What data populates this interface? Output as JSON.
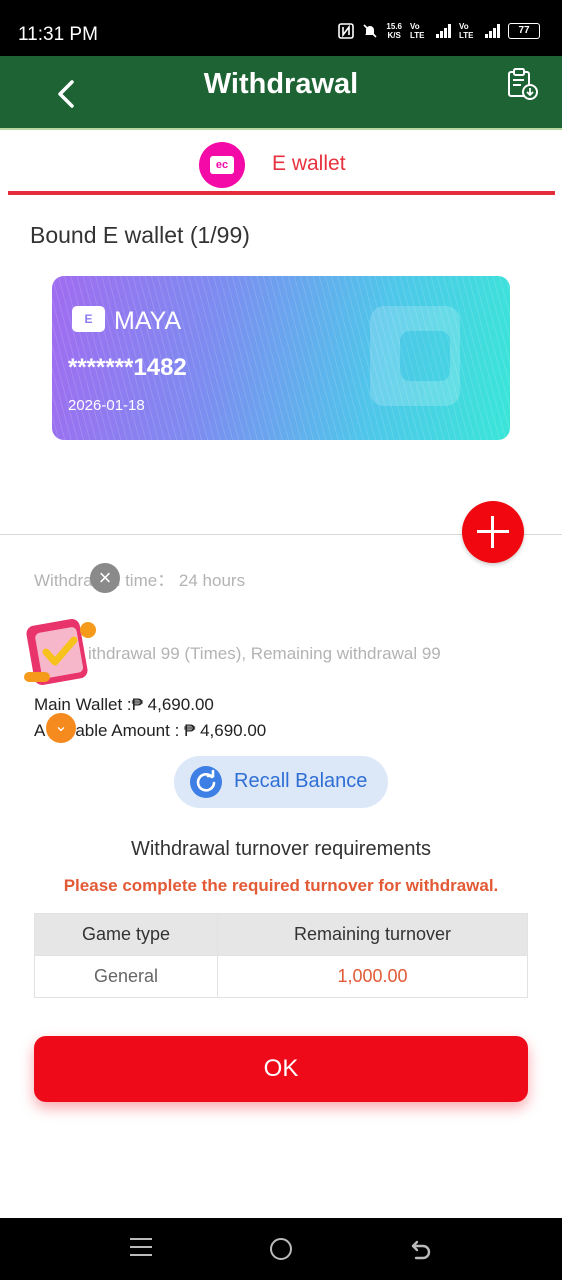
{
  "status_bar": {
    "time": "11:31 PM",
    "net_speed": "15.6",
    "net_unit": "K/S",
    "sim1": "Vo LTE",
    "sim2": "Vo LTE",
    "battery": "77"
  },
  "header": {
    "title": "Withdrawal",
    "back_icon": "chevron-left-icon",
    "record_icon": "clipboard-download-icon"
  },
  "tabs": [
    {
      "label": "E wallet",
      "icon": "ewallet-icon",
      "active": true,
      "accent": "#e42d3a"
    }
  ],
  "bound": {
    "title": "Bound E wallet (1/99)"
  },
  "card": {
    "name": "MAYA",
    "number": "*******1482",
    "date": "2026-01-18",
    "logo_text": "E"
  },
  "info": {
    "withdraw_time_prefix": "Withdra",
    "withdraw_time_suffix": "l time：  24 hours",
    "withdraw_times": "ithdrawal 99 (Times), Remaining withdrawal 99",
    "main_wallet": "Main Wallet :₱ 4,690.00",
    "available_prefix": "A",
    "available_suffix": "able Amount : ₱ 4,690.00"
  },
  "recall": {
    "label": "Recall Balance"
  },
  "turnover": {
    "title": "Withdrawal turnover requirements",
    "warning": "Please complete the required turnover for withdrawal.",
    "columns": [
      "Game type",
      "Remaining turnover"
    ],
    "rows": [
      {
        "game_type": "General",
        "remaining": "1,000.00"
      }
    ]
  },
  "ok_button": {
    "label": "OK"
  },
  "colors": {
    "header_bg": "#1e6334",
    "accent_red": "#ef0a1a",
    "warning": "#e25a36",
    "recall_blue": "#3d7fe4"
  }
}
